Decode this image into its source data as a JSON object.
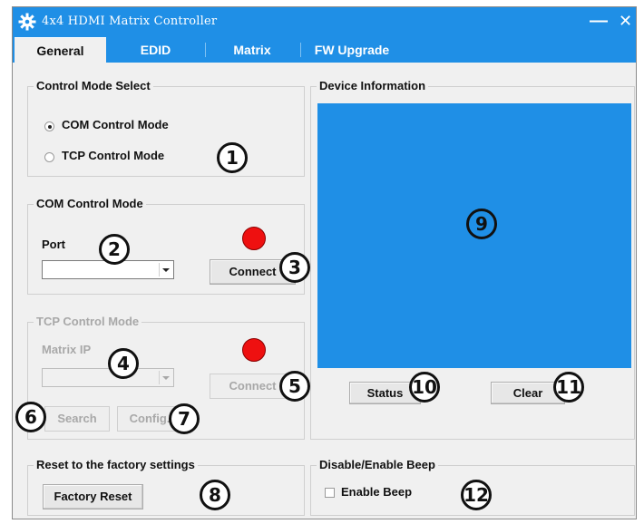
{
  "window": {
    "title": "4x4 HDMI Matrix Controller",
    "minimize_glyph": "—",
    "close_glyph": "✕",
    "accent_color": "#1f8fe6"
  },
  "tabs": [
    {
      "label": "General",
      "active": true
    },
    {
      "label": "EDID",
      "active": false
    },
    {
      "label": "Matrix",
      "active": false
    },
    {
      "label": "FW Upgrade",
      "active": false
    }
  ],
  "control_mode_select": {
    "title": "Control Mode Select",
    "options": [
      {
        "label": "COM Control Mode",
        "selected": true
      },
      {
        "label": "TCP Control Mode",
        "selected": false
      }
    ]
  },
  "com_control_mode": {
    "title": "COM Control Mode",
    "port_label": "Port",
    "port_value": "",
    "connect_label": "Connect",
    "status_led_color": "#ee1010"
  },
  "tcp_control_mode": {
    "title": "TCP Control Mode",
    "matrix_ip_label": "Matrix  IP",
    "matrix_ip_value": "",
    "connect_label": "Connect",
    "search_label": "Search",
    "config_label": "Config.",
    "status_led_color": "#ee1010",
    "enabled": false
  },
  "device_information": {
    "title": "Device Information",
    "status_label": "Status",
    "clear_label": "Clear"
  },
  "reset_factory": {
    "title": "Reset to the factory settings",
    "button_label": "Factory Reset"
  },
  "beep": {
    "title": "Disable/Enable Beep",
    "checkbox_label": "Enable Beep",
    "checked": false
  },
  "callouts": [
    "1",
    "2",
    "3",
    "4",
    "5",
    "6",
    "7",
    "8",
    "9",
    "10",
    "11",
    "12"
  ]
}
